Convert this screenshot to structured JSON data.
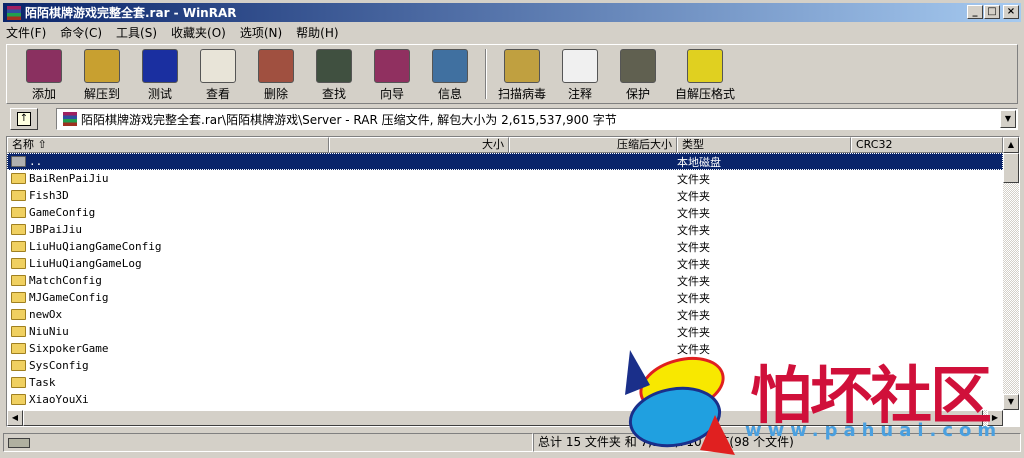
{
  "window": {
    "title": "陌陌棋牌游戏完整全套.rar - WinRAR",
    "minimize": "_",
    "maximize": "□",
    "close": "×"
  },
  "menu": [
    "文件(F)",
    "命令(C)",
    "工具(S)",
    "收藏夹(O)",
    "选项(N)",
    "帮助(H)"
  ],
  "toolbar": [
    {
      "label": "添加",
      "icon": "add-archive-icon",
      "color": "#8a3060"
    },
    {
      "label": "解压到",
      "icon": "extract-icon",
      "color": "#c8a030"
    },
    {
      "label": "测试",
      "icon": "test-icon",
      "color": "#1a2fa0"
    },
    {
      "label": "查看",
      "icon": "view-icon",
      "color": "#e8e4d8"
    },
    {
      "label": "删除",
      "icon": "delete-icon",
      "color": "#a05040"
    },
    {
      "label": "查找",
      "icon": "find-icon",
      "color": "#405040"
    },
    {
      "label": "向导",
      "icon": "wizard-icon",
      "color": "#903060"
    },
    {
      "label": "信息",
      "icon": "info-icon",
      "color": "#4070a0"
    },
    {
      "label": "扫描病毒",
      "icon": "virus-scan-icon",
      "color": "#c0a040"
    },
    {
      "label": "注释",
      "icon": "comment-icon",
      "color": "#f0f0f0"
    },
    {
      "label": "保护",
      "icon": "protect-icon",
      "color": "#606050"
    },
    {
      "label": "自解压格式",
      "icon": "sfx-icon",
      "color": "#e0d020"
    }
  ],
  "address": {
    "up": "↑",
    "path": "陌陌棋牌游戏完整全套.rar\\陌陌棋牌游戏\\Server - RAR 压缩文件, 解包大小为 2,615,537,900 字节",
    "dropdown": "▼"
  },
  "columns": {
    "name": "名称 ⇧",
    "size": "大小",
    "packed": "压缩后大小",
    "type": "类型",
    "crc": "CRC32"
  },
  "rows": [
    {
      "name": "..",
      "type": "本地磁盘",
      "selected": true
    },
    {
      "name": "BaiRenPaiJiu",
      "type": "文件夹"
    },
    {
      "name": "Fish3D",
      "type": "文件夹"
    },
    {
      "name": "GameConfig",
      "type": "文件夹"
    },
    {
      "name": "JBPaiJiu",
      "type": "文件夹"
    },
    {
      "name": "LiuHuQiangGameConfig",
      "type": "文件夹"
    },
    {
      "name": "LiuHuQiangGameLog",
      "type": "文件夹"
    },
    {
      "name": "MatchConfig",
      "type": "文件夹"
    },
    {
      "name": "MJGameConfig",
      "type": "文件夹"
    },
    {
      "name": "newOx",
      "type": "文件夹"
    },
    {
      "name": "NiuNiu",
      "type": "文件夹"
    },
    {
      "name": "SixpokerGame",
      "type": "文件夹"
    },
    {
      "name": "SysConfig",
      "type": "文件夹"
    },
    {
      "name": "Task",
      "type": "文件夹"
    },
    {
      "name": "XiaoYouXi",
      "type": "文件夹"
    }
  ],
  "status": {
    "summary": "总计 15 文件夹 和 7,172,710 字节(98 个文件)"
  },
  "watermark": {
    "text": "怕坏社区",
    "url": "www.pahuai.com"
  }
}
